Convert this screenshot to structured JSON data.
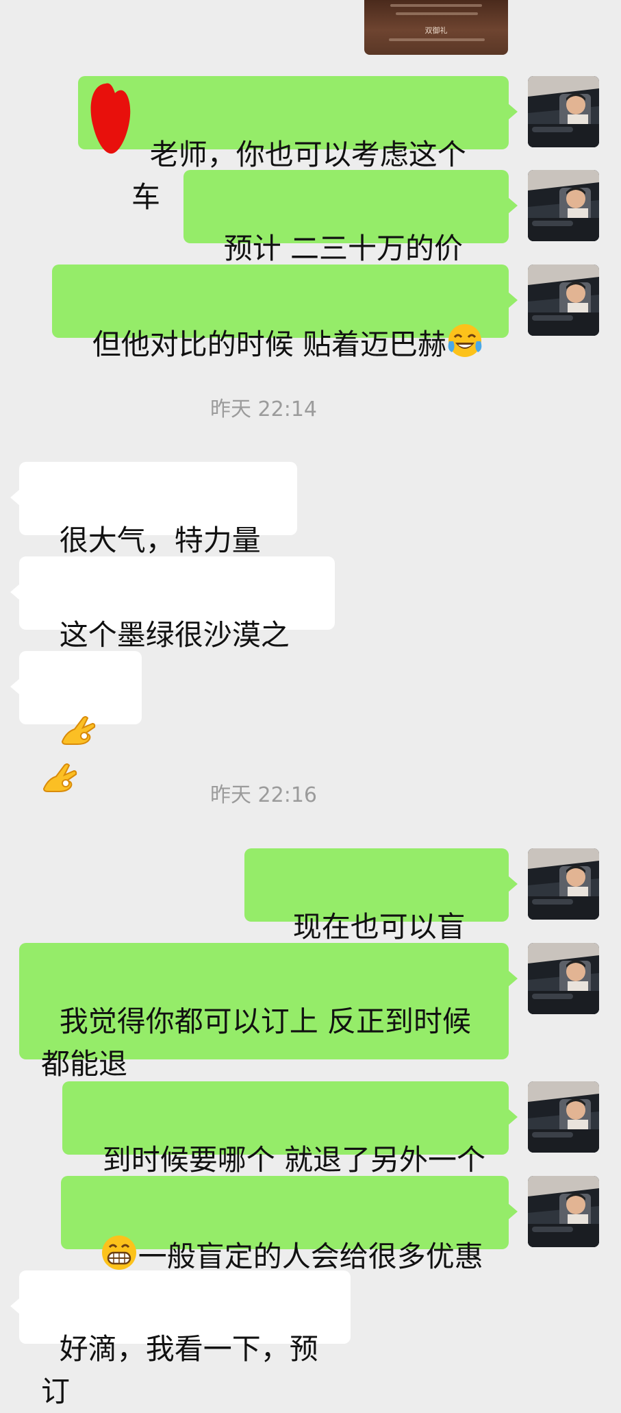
{
  "shared_image": {
    "caption": "双御礼"
  },
  "timestamps": {
    "t1": "昨天 22:14",
    "t2": "昨天 22:16"
  },
  "messages": {
    "m1": "老师，你也可以考虑这个车",
    "m2": "预计 二三十万的价格",
    "m3": "但他对比的时候 贴着迈巴赫",
    "m4": "很大气，特力量感",
    "m5": "这个墨绿很沙漠之舟",
    "m6": "👌👌",
    "m7": "现在也可以盲订",
    "m8": "我觉得你都可以订上 反正到时候都能退",
    "m9": "到时候要哪个 就退了另外一个",
    "m10": "一般盲定的人会给很多优惠",
    "m11": "好滴，我看一下，预订"
  },
  "icons": {
    "laugh_emoji": "tears-of-joy-emoji",
    "grin_emoji": "grinning-emoji",
    "ok_emoji": "ok-hand-emoji"
  },
  "colors": {
    "background": "#ededed",
    "outgoing_bubble": "#95ec69",
    "incoming_bubble": "#ffffff",
    "timestamp_text": "#9b9b9b"
  }
}
